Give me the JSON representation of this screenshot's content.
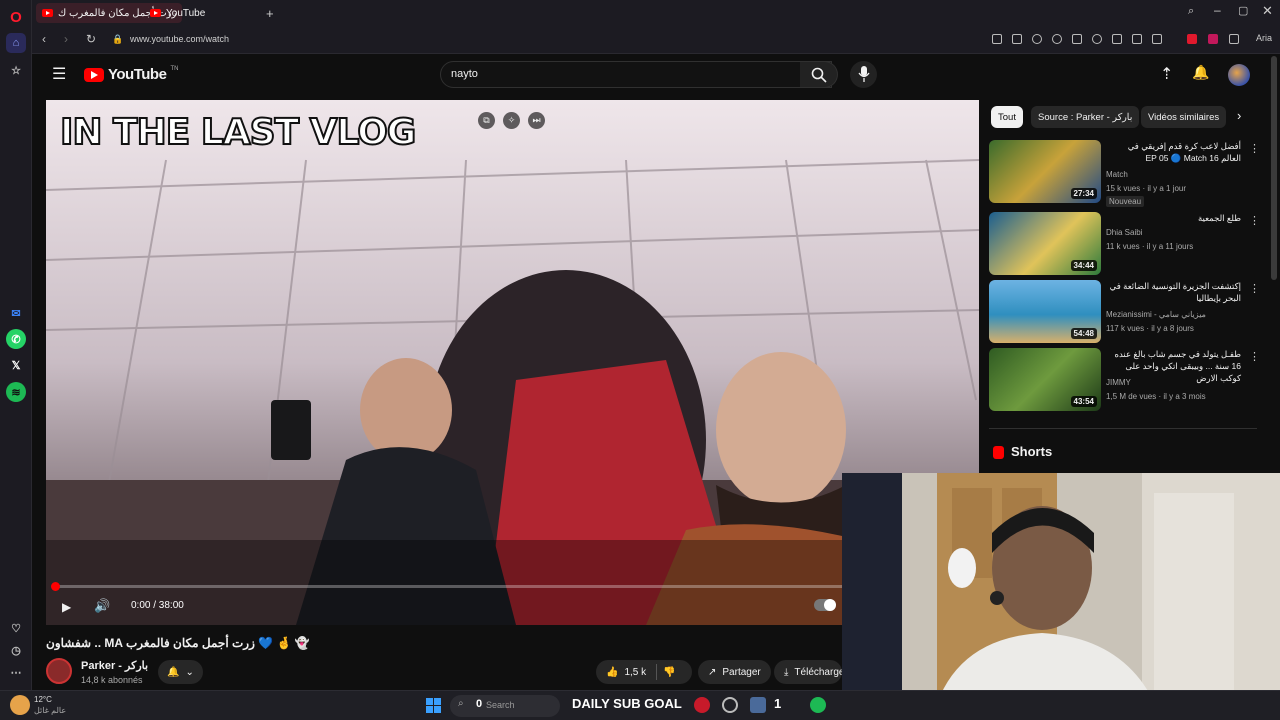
{
  "browser": {
    "tabs": [
      {
        "label": "زرت أجمل مكان فالمغرب ك"
      },
      {
        "label": "YouTube"
      }
    ],
    "url": "www.youtube.com/watch",
    "ai_label": "Aria"
  },
  "youtube": {
    "logo_text": "YouTube",
    "logo_tm": "TN",
    "search_value": "nayto"
  },
  "player": {
    "overlay_headline": "IN THE LAST VLOG",
    "time": "0:00 / 38:00",
    "progress": 0
  },
  "video": {
    "title": "شفشاون .. MA زرت أجمل مكان فالمغرب 💙 🤞 👻",
    "channel": "Parker - باركر",
    "subscribers": "14,8 k abonnés",
    "likes": "1,5 k",
    "share_label": "Partager",
    "download_label": "Télécharger"
  },
  "chips": [
    {
      "label": "Tout",
      "active": true
    },
    {
      "label": "Source : Parker - باركر",
      "active": false
    },
    {
      "label": "Vidéos similaires",
      "active": false
    }
  ],
  "recommendations": [
    {
      "title": "أفضل لاعب كرة قدم إفريقي في العالم EP 05 🔵 Match 16",
      "channel": "Match",
      "meta": "15 k vues · il y a 1 jour",
      "badge": "Nouveau",
      "duration": "27:34"
    },
    {
      "title": "طلع الجمعية",
      "channel": "Dhia Saibi",
      "meta": "11 k vues · il y a 11 jours",
      "badge": "",
      "duration": "34:44"
    },
    {
      "title": "إكتشفت الجزيرة التونسية الضائعة في البحر بإيطاليا",
      "channel": "Mezianissimi - ميزياني سامي",
      "meta": "117 k vues · il y a 8 jours",
      "badge": "",
      "duration": "54:48"
    },
    {
      "title": "طفـل يتولد في جسم شاب بالغ عنده 16 سنة ... وبيبقى اتكي واحد على كوكب الارض",
      "channel": "JIMMY",
      "meta": "1,5 M de vues · il y a 3 mois",
      "badge": "",
      "duration": "43:54"
    }
  ],
  "shorts_label": "Shorts",
  "taskbar": {
    "weather_temp": "12°C",
    "weather_desc": "عالم غائل",
    "search_placeholder": "Search",
    "search_count": "0",
    "goal_text": "DAILY SUB GOAL",
    "counter": "1"
  },
  "colors": {
    "accent": "#ff0000",
    "bg": "#0f0f0f",
    "chip": "#272727"
  }
}
